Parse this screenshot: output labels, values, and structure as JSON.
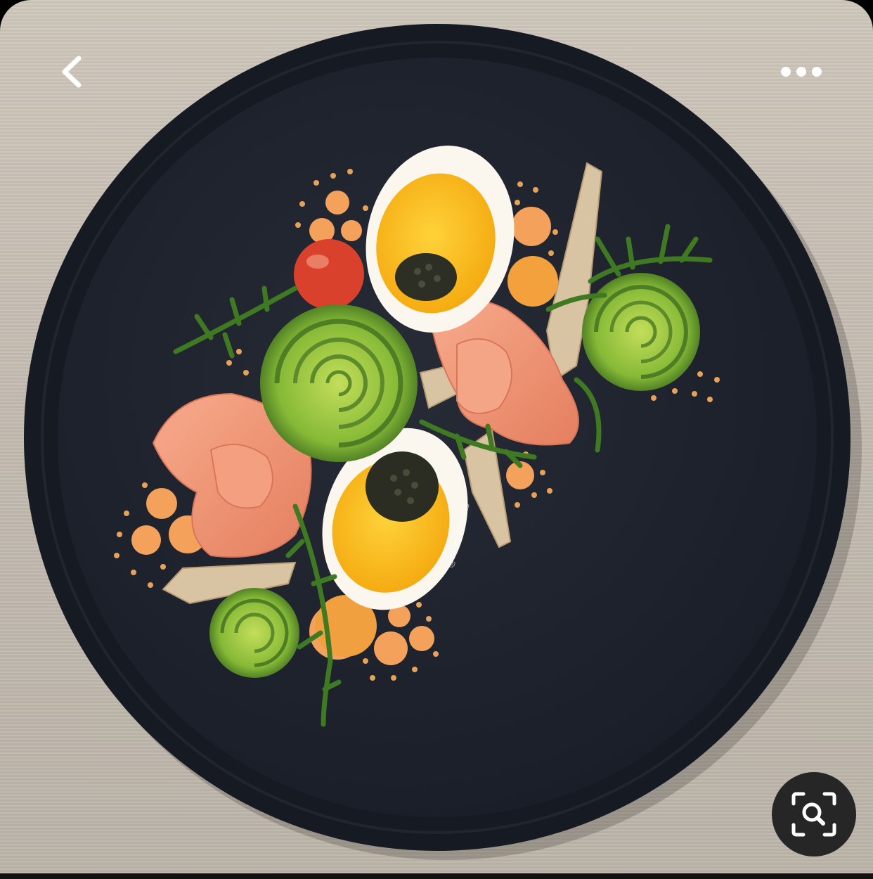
{
  "photo": {
    "subject": "plated-dish-photo",
    "watermark_text": "@m0mmyeats"
  },
  "toolbar": {
    "back_icon": "chevron-left-icon",
    "more_icon": "more-horizontal-icon"
  },
  "visual_search": {
    "icon": "visual-search-icon"
  },
  "colors": {
    "background": "#c6bfb4",
    "plate": "#1f2430",
    "button_bg": "#262626",
    "icon": "#ffffff",
    "avocado": "#8fbf3a",
    "yolk": "#f5b51c",
    "salmon": "#f19676",
    "sauce_dot": "#f5a05a"
  }
}
